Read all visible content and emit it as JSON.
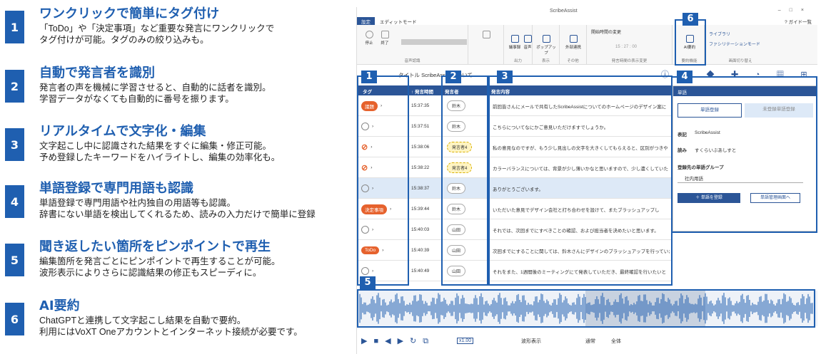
{
  "features": [
    {
      "num": "1",
      "title": "ワンクリックで簡単にタグ付け",
      "desc": "「ToDo」や「決定事項」など重要な発言にワンクリックで\nタグ付けが可能。タグのみの絞り込みも。"
    },
    {
      "num": "2",
      "title": "自動で発言者を識別",
      "desc": "発言者の声を機械に学習させると、自動的に話者を識別。\n学習データがなくても自動的に番号を振ります。"
    },
    {
      "num": "3",
      "title": "リアルタイムで文字化・編集",
      "desc": "文字起こし中に認識された結果をすぐに編集・修正可能。\n予め登録したキーワードをハイライトし、編集の効率化も。"
    },
    {
      "num": "4",
      "title": "単語登録で専門用語も認識",
      "desc": "単語登録で専門用語や社内独自の用語等も認識。\n辞書にない単語を検出してくれるため、読みの入力だけで簡単に登録"
    },
    {
      "num": "5",
      "title": "聞き返したい箇所をピンポイントで再生",
      "desc": "編集箇所を発言ごとにピンポイントで再生することが可能。\n波形表示によりさらに認識結果の修正もスピーディに。"
    },
    {
      "num": "6",
      "title": "AI要約",
      "desc": "ChatGPTと連携して文字起こし結果を自動で要約。\n利用にはVoXT Oneアカウントとインターネット接続が必要です。"
    }
  ],
  "app": {
    "title": "ScribeAssist",
    "tabs": [
      "設定",
      "エディットモード"
    ],
    "help": "ガイド一覧",
    "ribbon": {
      "groups": [
        {
          "cap": "音声認識",
          "items": [
            "停止",
            "終了"
          ]
        },
        {
          "cap": "出力",
          "items": [
            "議事録",
            "音声"
          ]
        },
        {
          "cap": "表示",
          "items": [
            "ポップアップ"
          ]
        },
        {
          "cap": "その他",
          "items": [
            "外部連携"
          ]
        },
        {
          "cap": "発言時間の表示変更",
          "items": [
            "開始時間の変更"
          ]
        },
        {
          "cap": "要約機能",
          "items": [
            "AI要約"
          ]
        },
        {
          "cap": "画面切り替え",
          "items": [
            "ライブラリ",
            "ファシリテーションモード"
          ]
        }
      ],
      "time": "15 : 27 : 00"
    },
    "title_label": "タイトル ScribeAssist ...ついて",
    "headers": [
      "タグ",
      "↑ 発言時間",
      "発言者",
      "発言内容"
    ],
    "rows": [
      {
        "tag": "議題",
        "time": "15:37:35",
        "speaker": "鈴木",
        "text": "前回皆さんにメールで共有したScribeAssistについてのホームページのデザイン案に"
      },
      {
        "tag": "",
        "time": "15:37:51",
        "speaker": "鈴木",
        "text": "こちらについてなにかご意見いただけますでしょうか。"
      },
      {
        "tag": "check",
        "time": "15:38:06",
        "speaker": "発言者4",
        "text": "私の意見なのですが、もう少し見出しの文字を大きくしてもらえると、区別がつきや"
      },
      {
        "tag": "check",
        "time": "15:38:22",
        "speaker": "発言者4",
        "text": "カラーバランスについては、背景が少し薄いかなと思いますので、少し濃くしていた"
      },
      {
        "tag": "",
        "time": "15:38:37",
        "speaker": "鈴木",
        "text": "ありがとうございます。"
      },
      {
        "tag": "決定事項",
        "time": "15:39:44",
        "speaker": "鈴木",
        "text": "いただいた意見でデザイン会社と打ち合わせを設けて、またブラッシュアップし"
      },
      {
        "tag": "",
        "time": "15:40:03",
        "speaker": "山田",
        "text": "それでは、次回までにすべきことの確認、および担当者を決めたいと思います。"
      },
      {
        "tag": "ToDo",
        "time": "15:40:39",
        "speaker": "山田",
        "text": "次回までにすることに関しては、鈴木さんにデザインのブラッシュアップを行っていただ"
      },
      {
        "tag": "",
        "time": "15:40:49",
        "speaker": "山田",
        "text": "それをまた、1週間後のミーティングにて発表していただき、最終確認を行いたいと"
      }
    ],
    "side": {
      "title": "単語",
      "tab1": "単語登録",
      "tab2": "未登録単語登録",
      "label_notation": "表記",
      "notation": "ScribeAssist",
      "label_reading": "読み",
      "reading": "すくらいぶあしすと",
      "group_label": "登録先の単語グループ",
      "group": "社内用語",
      "btn_register": "＋ 単語を登録",
      "btn_manage": "単語管理画面へ"
    },
    "controls": {
      "speed": "x1.00",
      "wave": "波形表示",
      "opt1": "通常",
      "opt2": "全体"
    }
  },
  "colors": {
    "accent": "#1f5fb0",
    "tag": "#e6622d"
  }
}
